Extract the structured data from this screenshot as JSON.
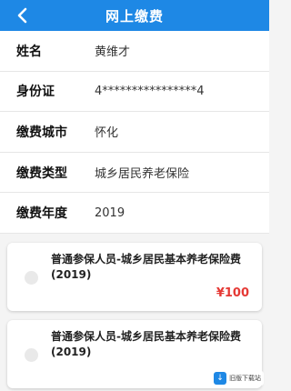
{
  "header": {
    "title": "网上缴费",
    "back_icon": "chevron-left-icon"
  },
  "info_rows": [
    {
      "label": "姓名",
      "value": "黄维才"
    },
    {
      "label": "身份证",
      "value": "4****************4"
    },
    {
      "label": "缴费城市",
      "value": "怀化"
    },
    {
      "label": "缴费类型",
      "value": "城乡居民养老保险"
    },
    {
      "label": "缴费年度",
      "value": "2019"
    }
  ],
  "items": [
    {
      "name": "普通参保人员-城乡居民基本养老保险费(2019)",
      "amount": "¥100"
    },
    {
      "name": "普通参保人员-城乡居民基本养老保险费(2019)",
      "amount": ""
    }
  ],
  "watermark": {
    "text": "旧版下载站"
  },
  "colors": {
    "primary": "#1e88e5",
    "amount": "#e53935"
  }
}
